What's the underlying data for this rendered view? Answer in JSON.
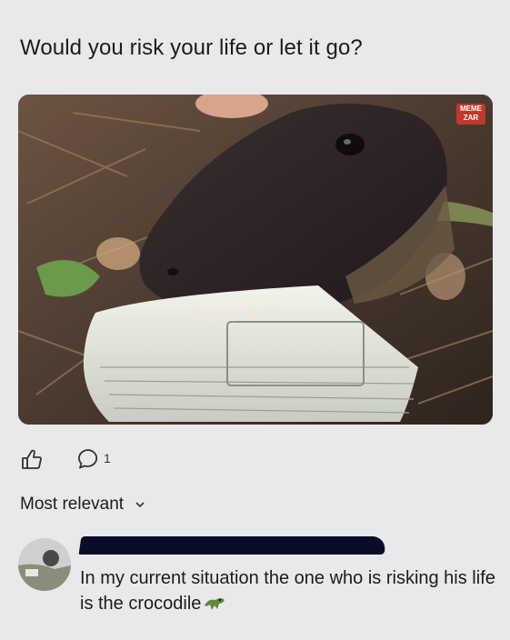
{
  "post": {
    "title": "Would you risk your life or let it go?",
    "watermark": "MEME ZAR"
  },
  "actions": {
    "like_icon": "thumbs-up-icon",
    "comment_icon": "comment-bubble-icon",
    "comment_count": "1"
  },
  "comments_section": {
    "sort_label": "Most relevant",
    "sort_icon": "chevron-down-icon"
  },
  "comment": {
    "text": "In my current situation the one who is risking his life is the crocodile",
    "emoji": "crocodile-emoji"
  },
  "colors": {
    "background": "#e9e9eb",
    "text": "#1c1c1e",
    "redaction": "#0b0c2a",
    "watermark": "#c0392b"
  }
}
